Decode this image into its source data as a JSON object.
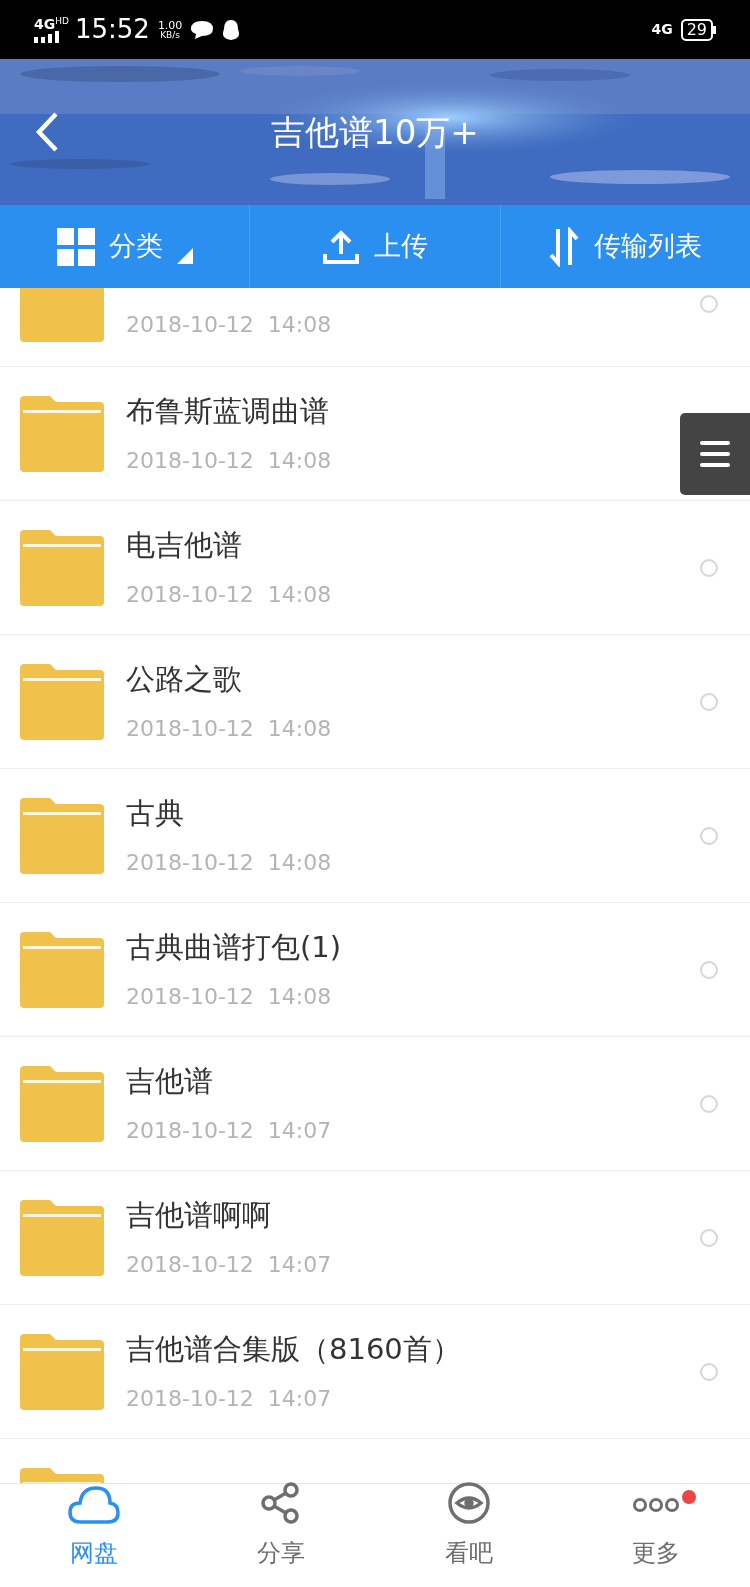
{
  "status_bar": {
    "network": "4G",
    "network_badge": "HD",
    "time": "15:52",
    "speed": "1.00",
    "speed_unit": "KB/s",
    "network_right": "4G",
    "battery": "29"
  },
  "header": {
    "title": "吉他谱10万+"
  },
  "toolbar": [
    {
      "label": "分类",
      "dropdown": true
    },
    {
      "label": "上传",
      "dropdown": false
    },
    {
      "label": "传输列表",
      "dropdown": false
    }
  ],
  "files": [
    {
      "kind": "cut_top",
      "date": "2018-10-12  14:08",
      "selected": false
    },
    {
      "kind": "full",
      "name": "布鲁斯蓝调曲谱",
      "date": "2018-10-12  14:08"
    },
    {
      "kind": "full",
      "name": "电吉他谱",
      "date": "2018-10-12  14:08",
      "selected": false
    },
    {
      "kind": "full",
      "name": "公路之歌",
      "date": "2018-10-12  14:08",
      "selected": false
    },
    {
      "kind": "full",
      "name": "古典",
      "date": "2018-10-12  14:08",
      "selected": false
    },
    {
      "kind": "full",
      "name": "古典曲谱打包(1)",
      "date": "2018-10-12  14:08",
      "selected": false
    },
    {
      "kind": "full",
      "name": "吉他谱",
      "date": "2018-10-12  14:07",
      "selected": false
    },
    {
      "kind": "full",
      "name": "吉他谱啊啊",
      "date": "2018-10-12  14:07",
      "selected": false
    },
    {
      "kind": "full",
      "name": "吉他谱合集版（8160首）",
      "date": "2018-10-12  14:07",
      "selected": false
    },
    {
      "kind": "cut_bottom"
    }
  ],
  "bottom_nav": [
    {
      "label": "网盘",
      "selected": true,
      "badge": false
    },
    {
      "label": "分享",
      "selected": false,
      "badge": false
    },
    {
      "label": "看吧",
      "selected": false,
      "badge": false
    },
    {
      "label": "更多",
      "selected": false,
      "badge": true
    }
  ]
}
